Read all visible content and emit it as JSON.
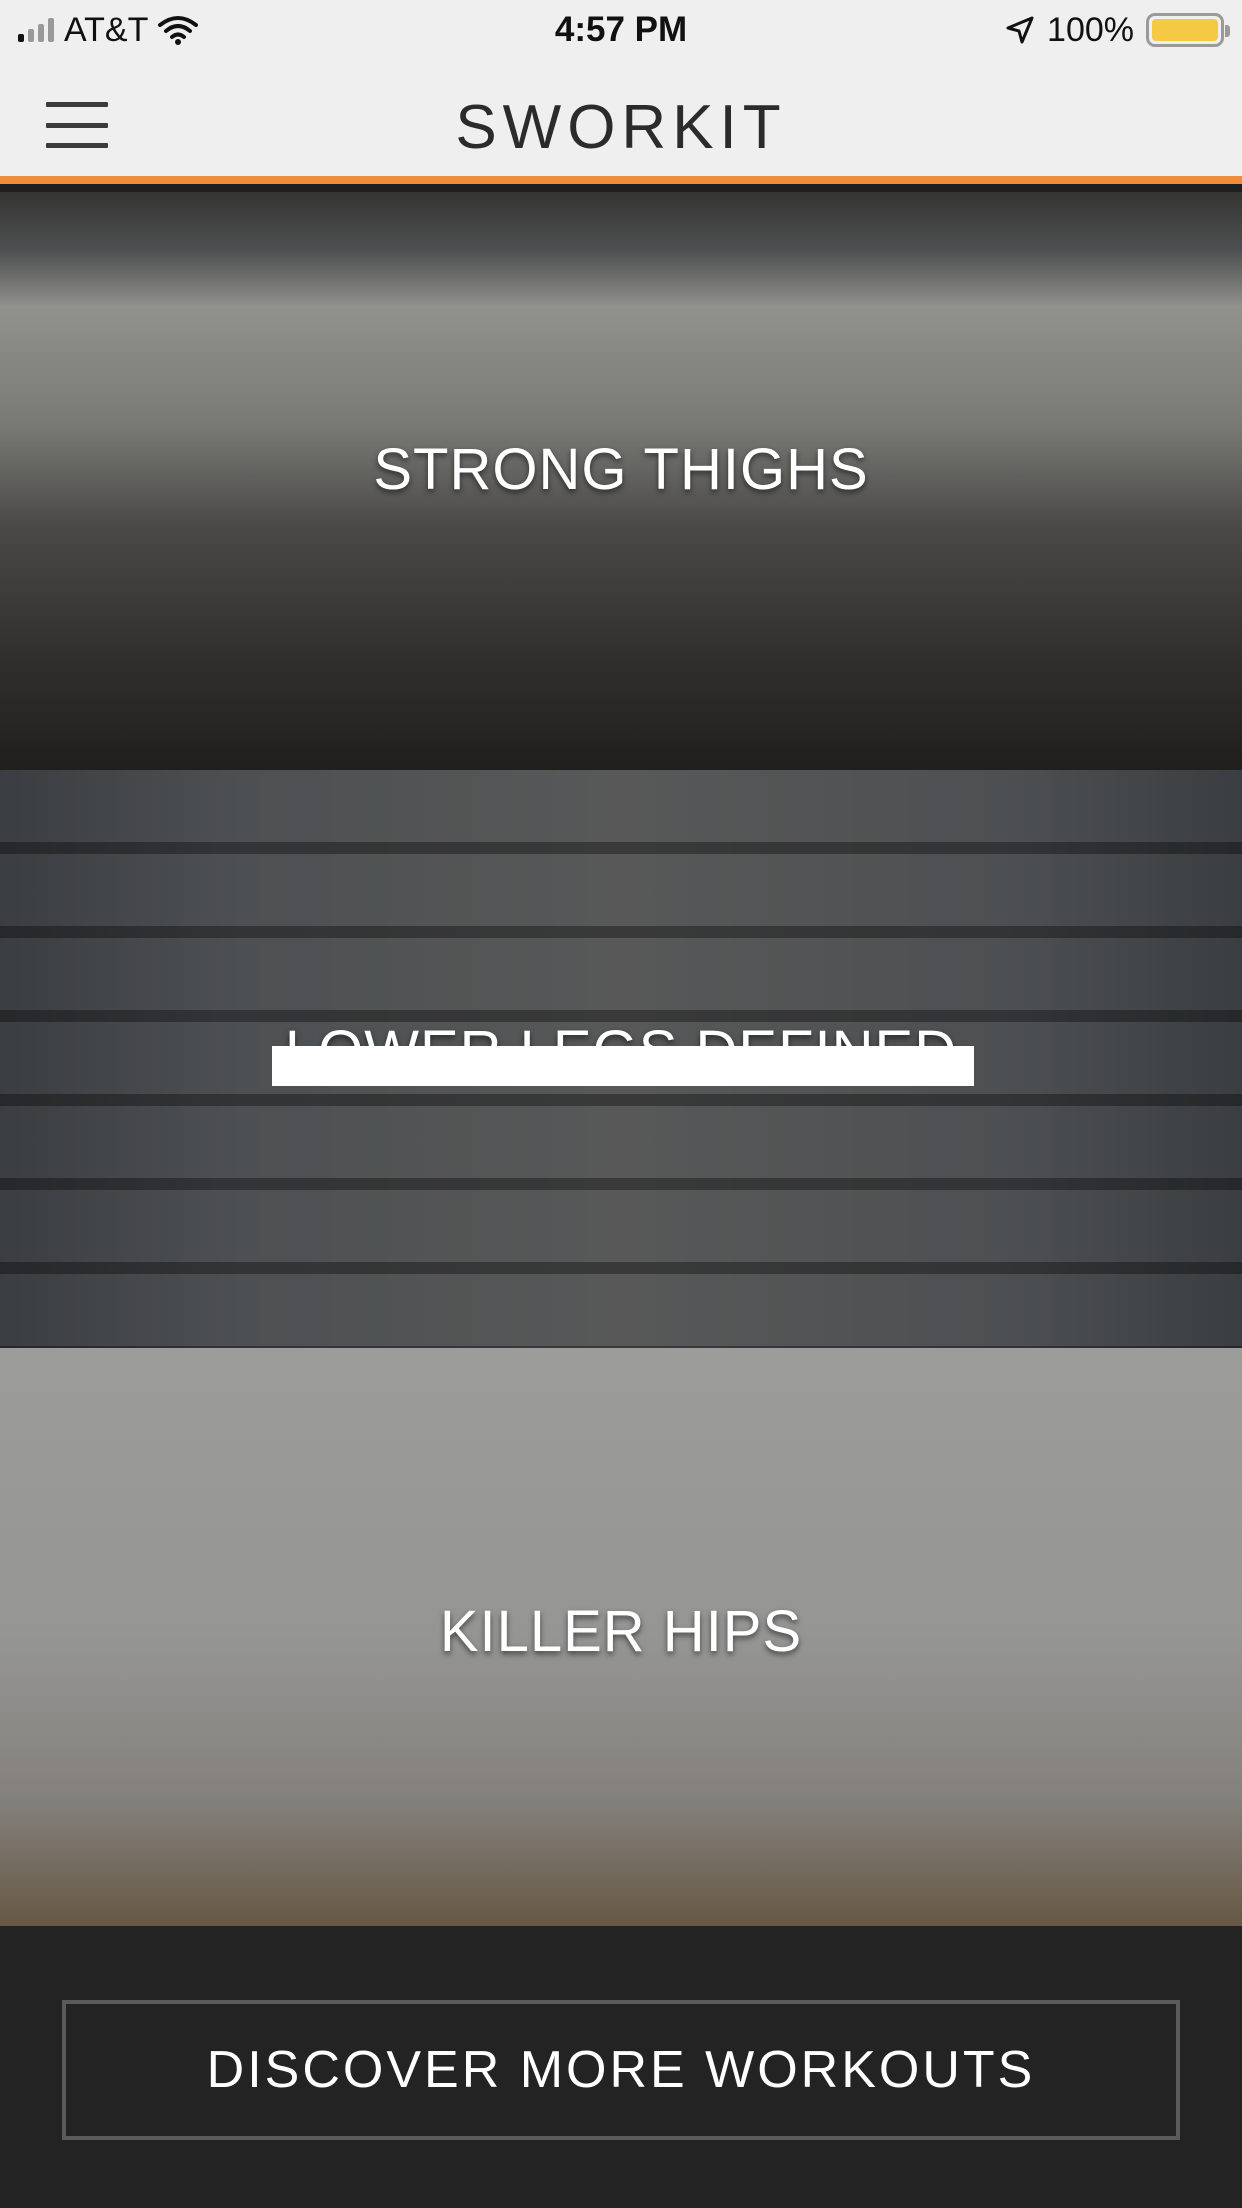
{
  "status_bar": {
    "carrier": "AT&T",
    "time": "4:57 PM",
    "battery": "100%",
    "battery_color": "#f6c945"
  },
  "header": {
    "logo": "SWORKIT",
    "accent_color": "#ef8d3a"
  },
  "workouts": [
    {
      "title": "STRONG THIGHS"
    },
    {
      "title": "LOWER LEGS DEFINED"
    },
    {
      "title": "KILLER HIPS"
    }
  ],
  "footer": {
    "discover_label": "DISCOVER MORE WORKOUTS"
  }
}
